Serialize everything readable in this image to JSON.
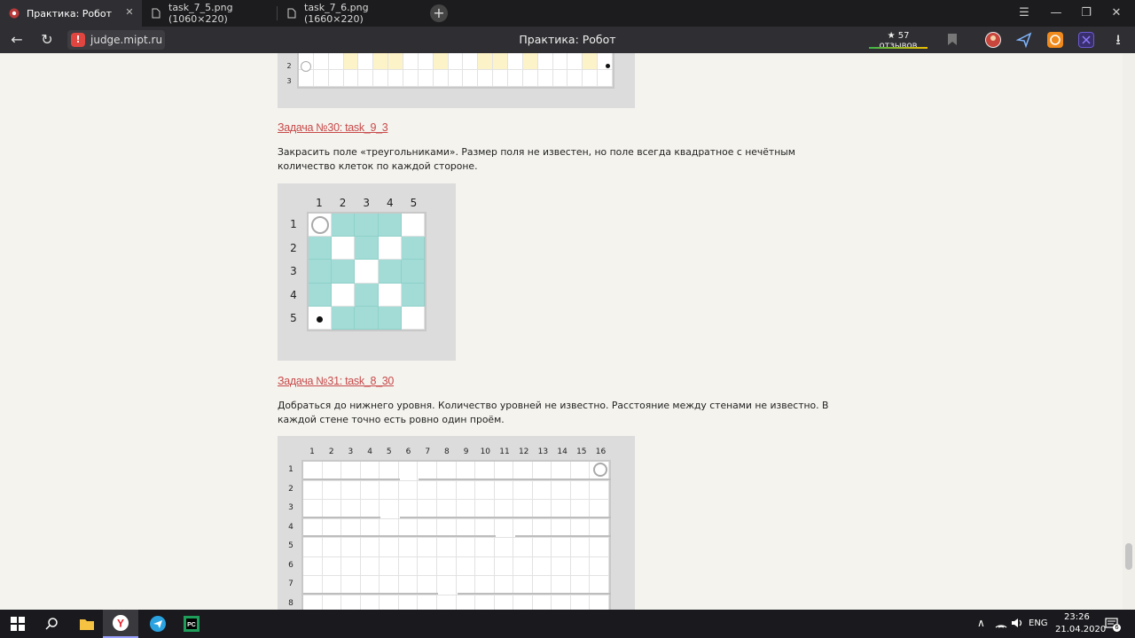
{
  "browser": {
    "tabs": [
      {
        "title": "Практика: Робот",
        "active": true
      },
      {
        "title": "task_7_5.png (1060×220)",
        "active": false
      },
      {
        "title": "task_7_6.png (1660×220)",
        "active": false
      }
    ],
    "new_tab_label": "+",
    "site": "judge.mipt.ru",
    "page_title": "Практика: Робот",
    "reviews": "★ 57 отзывов",
    "window_controls": {
      "menu": "☰",
      "minimize": "—",
      "restore": "❐",
      "close": "✕"
    }
  },
  "top_figure": {
    "row_labels": [
      "2",
      "3"
    ]
  },
  "task30": {
    "link": "Задача №30: task_9_3",
    "description": "Закрасить поле «треугольниками». Размер поля не известен, но поле всегда квадратное с нечётным количество клеток по каждой стороне.",
    "col_labels": [
      "1",
      "2",
      "3",
      "4",
      "5"
    ],
    "row_labels": [
      "1",
      "2",
      "3",
      "4",
      "5"
    ]
  },
  "task31": {
    "link": "Задача №31: task_8_30",
    "description": "Добраться до нижнего уровня. Количество уровней не известно. Расстояние между стенами не известно. В каждой стене точно есть ровно один проём.",
    "col_labels": [
      "1",
      "2",
      "3",
      "4",
      "5",
      "6",
      "7",
      "8",
      "9",
      "10",
      "11",
      "12",
      "13",
      "14",
      "15",
      "16"
    ],
    "row_labels": [
      "1",
      "2",
      "3",
      "4",
      "5",
      "6",
      "7",
      "8"
    ]
  },
  "taskbar": {
    "lang": "ENG",
    "time": "23:26",
    "date": "21.04.2020",
    "notifications": "6"
  }
}
